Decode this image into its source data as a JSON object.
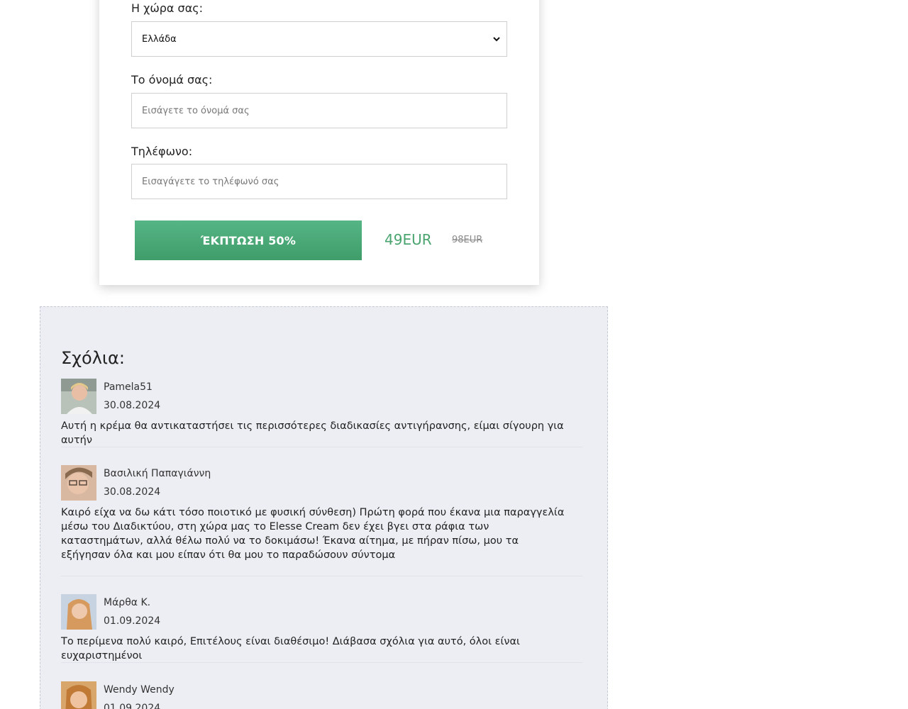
{
  "form": {
    "country_label": "Η χώρα σας:",
    "country_value": "Ελλάδα",
    "name_label": "Το όνομά σας:",
    "name_placeholder": "Εισάγετε το όνομά σας",
    "phone_label": "Τηλέφωνο:",
    "phone_placeholder": "Εισαγάγετε το τηλέφωνό σας",
    "submit_label": "ΈΚΠΤΩΣΗ 50%",
    "price_new": "49EUR",
    "price_old": "98EUR"
  },
  "comments": {
    "title": "Σχόλια:",
    "items": [
      {
        "author": "Pamela51",
        "date": "30.08.2024",
        "text": "Αυτή η κρέμα θα αντικαταστήσει τις περισσότερες διαδικασίες αντιγήρανσης, είμαι σίγουρη για αυτήν"
      },
      {
        "author": "Βασιλική Παπαγιάννη",
        "date": "30.08.2024",
        "text": "Καιρό είχα να δω κάτι τόσο ποιοτικό με φυσική σύνθεση) Πρώτη φορά που έκανα μια παραγγελία μέσω του Διαδικτύου, στη χώρα μας το Elesse Cream δεν έχει βγει στα ράφια των καταστημάτων, αλλά θέλω πολύ να το δοκιμάσω! Έκανα αίτημα, με πήραν πίσω, μου τα εξήγησαν όλα και μου είπαν ότι θα μου το παραδώσουν σύντομα"
      },
      {
        "author": "Μάρθα Κ.",
        "date": "01.09.2024",
        "text": "Το περίμενα πολύ καιρό, Επιτέλους είναι διαθέσιμο! Διάβασα σχόλια για αυτό, όλοι είναι ευχαριστημένοι"
      },
      {
        "author": "Wendy Wendy",
        "date": "01.09.2024",
        "text": ""
      }
    ]
  },
  "colors": {
    "accent_green": "#4aa46f",
    "comments_bg": "#eceef3"
  }
}
